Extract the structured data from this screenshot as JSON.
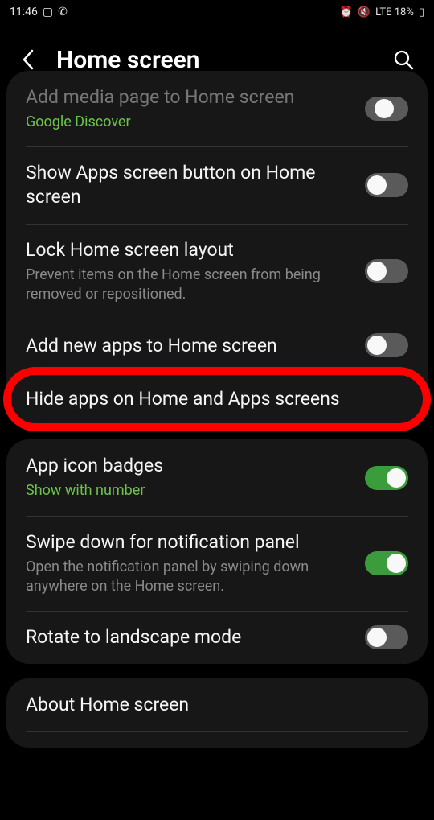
{
  "status": {
    "time": "11:46",
    "right": "LTE 18%"
  },
  "header": {
    "title": "Home screen"
  },
  "group1": {
    "mediaPage": {
      "title": "Add media page to Home screen",
      "sub": "Google Discover"
    },
    "showApps": {
      "title": "Show Apps screen button on Home screen"
    },
    "lockLayout": {
      "title": "Lock Home screen layout",
      "sub": "Prevent items on the Home screen from being removed or repositioned."
    },
    "addNew": {
      "title": "Add new apps to Home screen"
    },
    "hideApps": {
      "title": "Hide apps on Home and Apps screens"
    }
  },
  "group2": {
    "badges": {
      "title": "App icon badges",
      "sub": "Show with number"
    },
    "swipeDown": {
      "title": "Swipe down for notification panel",
      "sub": "Open the notification panel by swiping down anywhere on the Home screen."
    },
    "rotate": {
      "title": "Rotate to landscape mode"
    }
  },
  "group3": {
    "about": {
      "title": "About Home screen"
    }
  },
  "toggles": {
    "mediaPage": true,
    "showApps": false,
    "lockLayout": false,
    "addNew": false,
    "badges": true,
    "swipeDown": true,
    "rotate": false
  },
  "colors": {
    "accent": "#6cc24a",
    "highlight": "#fc0000",
    "toggleOn": "#3a9c3a"
  }
}
